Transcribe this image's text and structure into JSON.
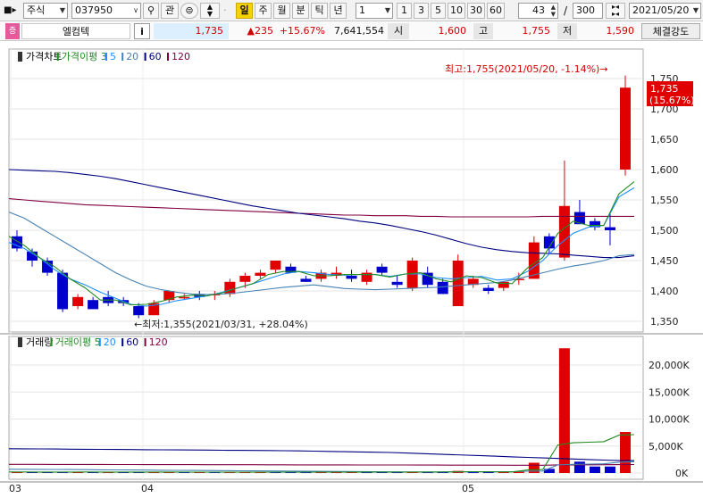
{
  "toolbar": {
    "market_select": "주식",
    "code_input": "037950",
    "buttons": [
      "관"
    ],
    "period_tabs": [
      "일",
      "주",
      "월",
      "분",
      "틱",
      "년"
    ],
    "active_period": "일",
    "interval_select": "1",
    "quick_intervals": [
      "1",
      "3",
      "5",
      "10",
      "30",
      "60"
    ],
    "view_count": "43",
    "view_sep": "/",
    "total_count": "300",
    "date_select": "2021/05/20"
  },
  "quote": {
    "badge": "증",
    "name": "엘컴텍",
    "info_btn": "i",
    "price": "1,735",
    "change": "▲235",
    "change_pct": "+15.67%",
    "volume": "7,641,554",
    "open_label": "시",
    "open": "1,600",
    "high_label": "고",
    "high": "1,755",
    "low_label": "저",
    "low": "1,590",
    "strength_btn": "체결강도"
  },
  "colors": {
    "up": "#e00000",
    "down": "#0000cc",
    "ma3": "#228b22",
    "ma5": "#1e90ff",
    "ma20": "#4682b4",
    "ma60": "#000080",
    "ma120": "#800040"
  },
  "price_chart": {
    "legend": [
      {
        "label": "가격차트",
        "color": "#000000"
      },
      {
        "label": "가격이평 3",
        "color": "#228b22"
      },
      {
        "label": "5",
        "color": "#1e90ff"
      },
      {
        "label": "20",
        "color": "#4682b4"
      },
      {
        "label": "60",
        "color": "#000080"
      },
      {
        "label": "120",
        "color": "#800040"
      }
    ],
    "y_ticks": [
      "1,750",
      "1,700",
      "1,650",
      "1,600",
      "1,550",
      "1,500",
      "1,450",
      "1,400",
      "1,350"
    ],
    "last_tag": [
      "1,735",
      "(15.67%)"
    ],
    "max_note": "최고:1,755(2021/05/20, -1.14%)→",
    "min_note": "←최저:1,355(2021/03/31, +28.04%)"
  },
  "volume_chart": {
    "legend": [
      {
        "label": "거래량",
        "color": "#000000"
      },
      {
        "label": "거래이평 5",
        "color": "#228b22"
      },
      {
        "label": "20",
        "color": "#1e90ff"
      },
      {
        "label": "60",
        "color": "#000080"
      },
      {
        "label": "120",
        "color": "#800040"
      }
    ],
    "y_ticks": [
      "20,000K",
      "15,000K",
      "10,000K",
      "5,000K",
      "0K"
    ]
  },
  "x_labels": [
    "03",
    "04",
    "05"
  ],
  "candles": [
    [
      1490,
      1500,
      1465,
      1470
    ],
    [
      1465,
      1470,
      1440,
      1450
    ],
    [
      1450,
      1455,
      1425,
      1430
    ],
    [
      1430,
      1435,
      1365,
      1370
    ],
    [
      1375,
      1395,
      1370,
      1390
    ],
    [
      1385,
      1390,
      1370,
      1370
    ],
    [
      1390,
      1400,
      1375,
      1380
    ],
    [
      1385,
      1390,
      1375,
      1380
    ],
    [
      1375,
      1380,
      1355,
      1360
    ],
    [
      1360,
      1385,
      1360,
      1380
    ],
    [
      1385,
      1400,
      1380,
      1400
    ],
    [
      1390,
      1395,
      1385,
      1390
    ],
    [
      1395,
      1400,
      1385,
      1390
    ],
    [
      1395,
      1400,
      1385,
      1395
    ],
    [
      1395,
      1420,
      1390,
      1415
    ],
    [
      1415,
      1430,
      1405,
      1425
    ],
    [
      1425,
      1435,
      1420,
      1430
    ],
    [
      1435,
      1445,
      1430,
      1450
    ],
    [
      1440,
      1445,
      1430,
      1430
    ],
    [
      1420,
      1425,
      1415,
      1415
    ],
    [
      1420,
      1435,
      1415,
      1430
    ],
    [
      1425,
      1440,
      1420,
      1430
    ],
    [
      1425,
      1435,
      1415,
      1420
    ],
    [
      1415,
      1435,
      1410,
      1430
    ],
    [
      1440,
      1445,
      1425,
      1430
    ],
    [
      1415,
      1425,
      1405,
      1410
    ],
    [
      1405,
      1455,
      1400,
      1450
    ],
    [
      1430,
      1440,
      1405,
      1410
    ],
    [
      1415,
      1420,
      1395,
      1395
    ],
    [
      1375,
      1460,
      1375,
      1450
    ],
    [
      1410,
      1425,
      1405,
      1420
    ],
    [
      1405,
      1410,
      1395,
      1400
    ],
    [
      1405,
      1415,
      1400,
      1415
    ],
    [
      1420,
      1430,
      1410,
      1420
    ],
    [
      1420,
      1490,
      1420,
      1480
    ],
    [
      1490,
      1495,
      1460,
      1470
    ],
    [
      1455,
      1615,
      1450,
      1540
    ],
    [
      1530,
      1550,
      1510,
      1510
    ],
    [
      1515,
      1520,
      1500,
      1505
    ],
    [
      1505,
      1530,
      1475,
      1500
    ],
    [
      1600,
      1755,
      1590,
      1735
    ]
  ],
  "volumes": [
    [
      170,
      "#e00000"
    ],
    [
      160,
      "#0000cc"
    ],
    [
      180,
      "#0000cc"
    ],
    [
      220,
      "#0000cc"
    ],
    [
      210,
      "#e00000"
    ],
    [
      170,
      "#0000cc"
    ],
    [
      200,
      "#e00000"
    ],
    [
      150,
      "#0000cc"
    ],
    [
      180,
      "#0000cc"
    ],
    [
      200,
      "#e00000"
    ],
    [
      170,
      "#e00000"
    ],
    [
      160,
      "#0000cc"
    ],
    [
      150,
      "#e00000"
    ],
    [
      150,
      "#0000cc"
    ],
    [
      170,
      "#e00000"
    ],
    [
      160,
      "#e00000"
    ],
    [
      160,
      "#e00000"
    ],
    [
      180,
      "#0000cc"
    ],
    [
      150,
      "#0000cc"
    ],
    [
      150,
      "#0000cc"
    ],
    [
      220,
      "#e00000"
    ],
    [
      160,
      "#e00000"
    ],
    [
      170,
      "#e00000"
    ],
    [
      200,
      "#0000cc"
    ],
    [
      190,
      "#0000cc"
    ],
    [
      200,
      "#0000cc"
    ],
    [
      220,
      "#e00000"
    ],
    [
      150,
      "#0000cc"
    ],
    [
      170,
      "#0000cc"
    ],
    [
      390,
      "#e00000"
    ],
    [
      180,
      "#0000cc"
    ],
    [
      190,
      "#0000cc"
    ],
    [
      200,
      "#e00000"
    ],
    [
      240,
      "#e00000"
    ],
    [
      1900,
      "#e00000"
    ],
    [
      770,
      "#0000cc"
    ],
    [
      23100,
      "#e00000"
    ],
    [
      2100,
      "#0000cc"
    ],
    [
      1200,
      "#0000cc"
    ],
    [
      1200,
      "#0000cc"
    ],
    [
      7600,
      "#e00000"
    ]
  ],
  "ma_lines": {
    "ma3": [
      1490,
      1475,
      1455,
      1440,
      1420,
      1405,
      1385,
      1385,
      1377,
      1378,
      1383,
      1390,
      1393,
      1392,
      1397,
      1405,
      1412,
      1427,
      1432,
      1432,
      1425,
      1425,
      1427,
      1427,
      1427,
      1423,
      1428,
      1430,
      1420,
      1415,
      1425,
      1422,
      1413,
      1412,
      1438,
      1455,
      1495,
      1515,
      1508,
      1508,
      1560,
      1580
    ],
    "ma5": [
      1480,
      1470,
      1455,
      1435,
      1420,
      1410,
      1398,
      1388,
      1378,
      1375,
      1378,
      1384,
      1388,
      1392,
      1398,
      1405,
      1412,
      1420,
      1428,
      1432,
      1430,
      1427,
      1426,
      1427,
      1427,
      1424,
      1428,
      1428,
      1422,
      1420,
      1422,
      1424,
      1418,
      1420,
      1432,
      1450,
      1475,
      1495,
      1505,
      1508,
      1555,
      1570
    ],
    "ma20": [
      1530,
      1520,
      1505,
      1490,
      1475,
      1460,
      1445,
      1430,
      1418,
      1408,
      1402,
      1398,
      1395,
      1394,
      1395,
      1397,
      1400,
      1403,
      1406,
      1408,
      1410,
      1407,
      1404,
      1403,
      1402,
      1403,
      1404,
      1405,
      1406,
      1408,
      1410,
      1412,
      1414,
      1418,
      1424,
      1430,
      1436,
      1441,
      1445,
      1450,
      1458,
      1460
    ],
    "ma60": [
      1600,
      1599,
      1598,
      1597,
      1595,
      1592,
      1589,
      1585,
      1580,
      1575,
      1570,
      1565,
      1560,
      1555,
      1550,
      1545,
      1540,
      1536,
      1532,
      1528,
      1525,
      1522,
      1519,
      1515,
      1512,
      1508,
      1503,
      1498,
      1492,
      1485,
      1478,
      1472,
      1468,
      1465,
      1463,
      1462,
      1461,
      1459,
      1457,
      1455,
      1455,
      1458
    ],
    "ma120": [
      1552,
      1550,
      1548,
      1546,
      1544,
      1542,
      1541,
      1540,
      1539,
      1538,
      1537,
      1536,
      1535,
      1534,
      1533,
      1532,
      1531,
      1530,
      1529,
      1528,
      1527,
      1526,
      1525,
      1525,
      1524,
      1524,
      1524,
      1523,
      1523,
      1522,
      1522,
      1522,
      1522,
      1522,
      1522,
      1523,
      1523,
      1523,
      1523,
      1523,
      1523,
      1523
    ]
  },
  "vol_ma": {
    "ma5": [
      200,
      200,
      190,
      185,
      190,
      200,
      180,
      180,
      180,
      175,
      180,
      180,
      170,
      165,
      160,
      165,
      160,
      160,
      160,
      160,
      170,
      170,
      170,
      175,
      180,
      185,
      190,
      185,
      190,
      220,
      240,
      230,
      220,
      200,
      560,
      640,
      5200,
      5600,
      5700,
      5800,
      7000,
      7100
    ],
    "ma20": [
      700,
      690,
      680,
      660,
      640,
      620,
      600,
      580,
      560,
      540,
      520,
      500,
      480,
      460,
      440,
      420,
      400,
      380,
      360,
      340,
      320,
      300,
      280,
      260,
      240,
      220,
      200,
      200,
      200,
      210,
      220,
      230,
      240,
      250,
      330,
      370,
      1500,
      1600,
      1650,
      1700,
      2000,
      2100
    ],
    "ma60": [
      4500,
      4480,
      4460,
      4440,
      4420,
      4400,
      4380,
      4360,
      4340,
      4320,
      4300,
      4280,
      4260,
      4240,
      4220,
      4200,
      4180,
      4160,
      4140,
      4100,
      4050,
      4000,
      3950,
      3900,
      3850,
      3800,
      3700,
      3600,
      3500,
      3400,
      3300,
      3200,
      3100,
      3000,
      2900,
      2800,
      2700,
      2600,
      2500,
      2400,
      2300,
      2300
    ],
    "ma120": [
      1600,
      1600,
      1600,
      1590,
      1590,
      1580,
      1580,
      1570,
      1570,
      1560,
      1560,
      1550,
      1550,
      1540,
      1540,
      1530,
      1530,
      1520,
      1520,
      1510,
      1510,
      1500,
      1500,
      1490,
      1490,
      1480,
      1480,
      1470,
      1470,
      1460,
      1460,
      1450,
      1450,
      1440,
      1440,
      1430,
      1500,
      1510,
      1520,
      1530,
      1560,
      1570
    ]
  }
}
